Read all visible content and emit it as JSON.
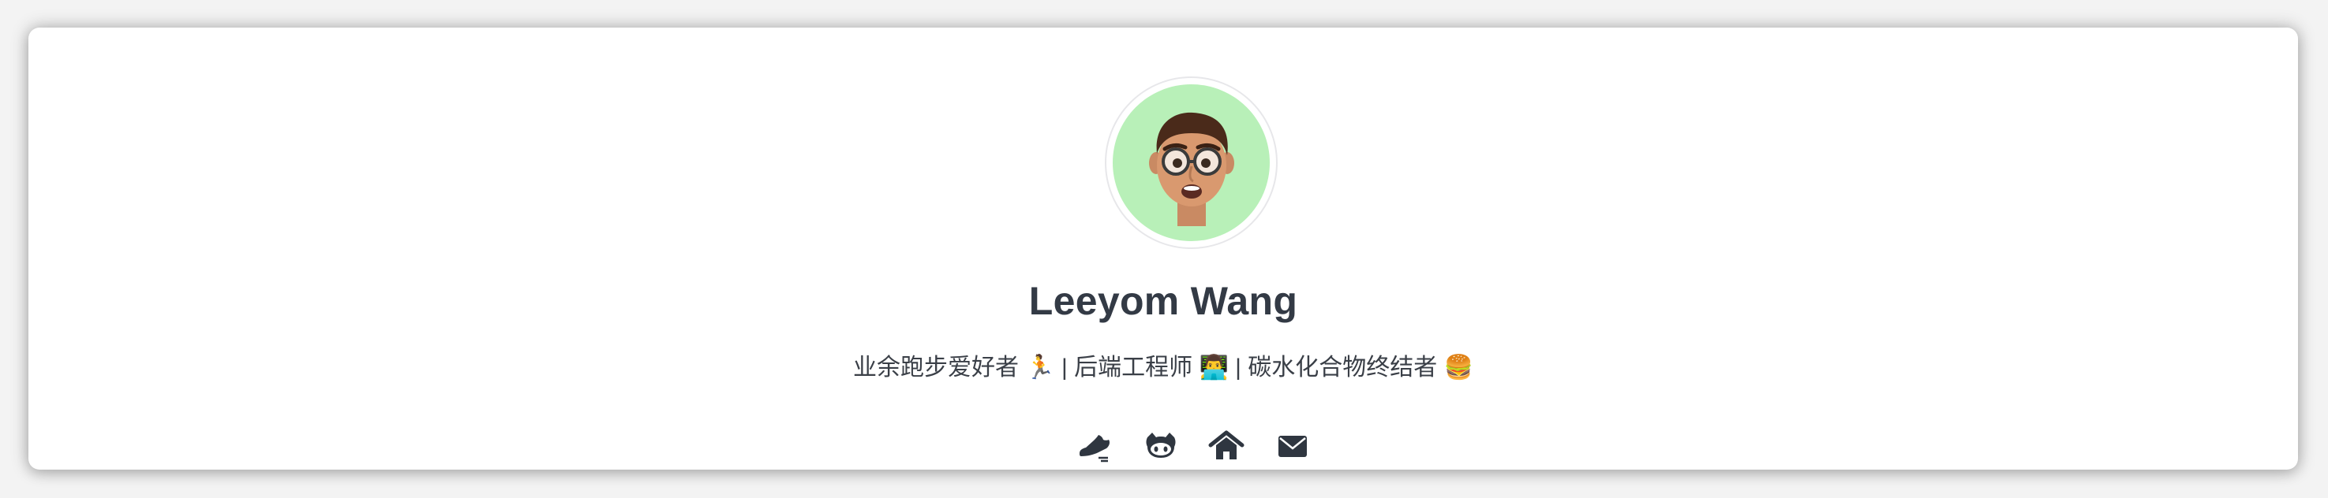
{
  "profile": {
    "name": "Leeyom Wang",
    "bio": "业余跑步爱好者 🏃 | 后端工程师 👨‍💻 | 碳水化合物终结者 🍔",
    "avatar_bg": "#b8f0b8"
  },
  "socials": [
    {
      "icon": "running-shoe-icon",
      "label": "running"
    },
    {
      "icon": "github-icon",
      "label": "github"
    },
    {
      "icon": "home-icon",
      "label": "home"
    },
    {
      "icon": "mail-icon",
      "label": "email"
    }
  ],
  "colors": {
    "text_dark": "#333a45",
    "icon": "#2f3640"
  }
}
